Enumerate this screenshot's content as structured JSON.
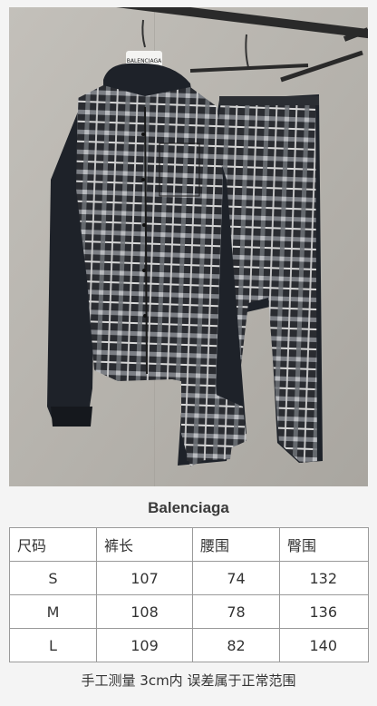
{
  "brand": "Balenciaga",
  "hanger_tag": "BALENCIAGA",
  "table": {
    "headers": [
      "尺码",
      "裤长",
      "腰围",
      "臀围"
    ],
    "rows": [
      [
        "S",
        "107",
        "74",
        "132"
      ],
      [
        "M",
        "108",
        "78",
        "136"
      ],
      [
        "L",
        "109",
        "82",
        "140"
      ]
    ]
  },
  "note": "手工测量 3cm内 误差属于正常范围",
  "colors": {
    "background": "#f4f4f4",
    "wall": "#b7b4ae",
    "garment_dark": "#1e2229"
  }
}
